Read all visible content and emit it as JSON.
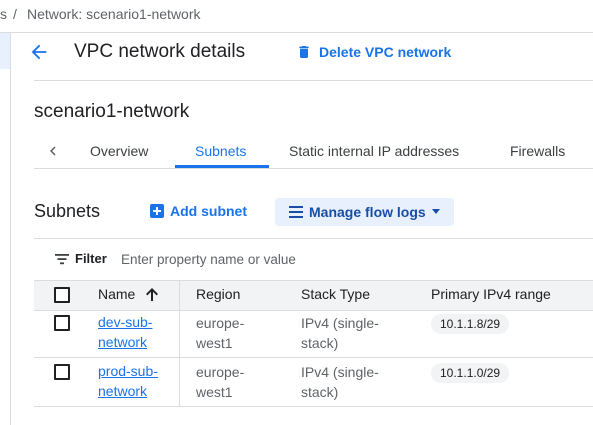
{
  "breadcrumb": {
    "prev_fragment": "s",
    "separator": "/",
    "current": "Network: scenario1-network"
  },
  "header": {
    "title": "VPC network details",
    "delete_label": "Delete VPC network"
  },
  "network_name": "scenario1-network",
  "tabs": [
    {
      "label": "Overview",
      "active": false
    },
    {
      "label": "Subnets",
      "active": true
    },
    {
      "label": "Static internal IP addresses",
      "active": false
    },
    {
      "label": "Firewalls",
      "active": false
    }
  ],
  "subnets_section": {
    "title": "Subnets",
    "add_label": "Add subnet",
    "flow_logs_label": "Manage flow logs"
  },
  "filter": {
    "label": "Filter",
    "placeholder": "Enter property name or value",
    "value": ""
  },
  "table": {
    "columns": [
      "Name",
      "Region",
      "Stack Type",
      "Primary IPv4 range"
    ],
    "rows": [
      {
        "name_line1": "dev-sub-",
        "name_line2": "network",
        "region_line1": "europe-",
        "region_line2": "west1",
        "stack_line1": "IPv4 (single-",
        "stack_line2": "stack)",
        "ipv4_range": "10.1.1.8/29"
      },
      {
        "name_line1": "prod-sub-",
        "name_line2": "network",
        "region_line1": "europe-",
        "region_line2": "west1",
        "stack_line1": "IPv4 (single-",
        "stack_line2": "stack)",
        "ipv4_range": "10.1.1.0/29"
      }
    ]
  },
  "colors": {
    "accent": "#1a73e8",
    "header_bg": "#f1f3f4",
    "divider": "#dadce0"
  }
}
